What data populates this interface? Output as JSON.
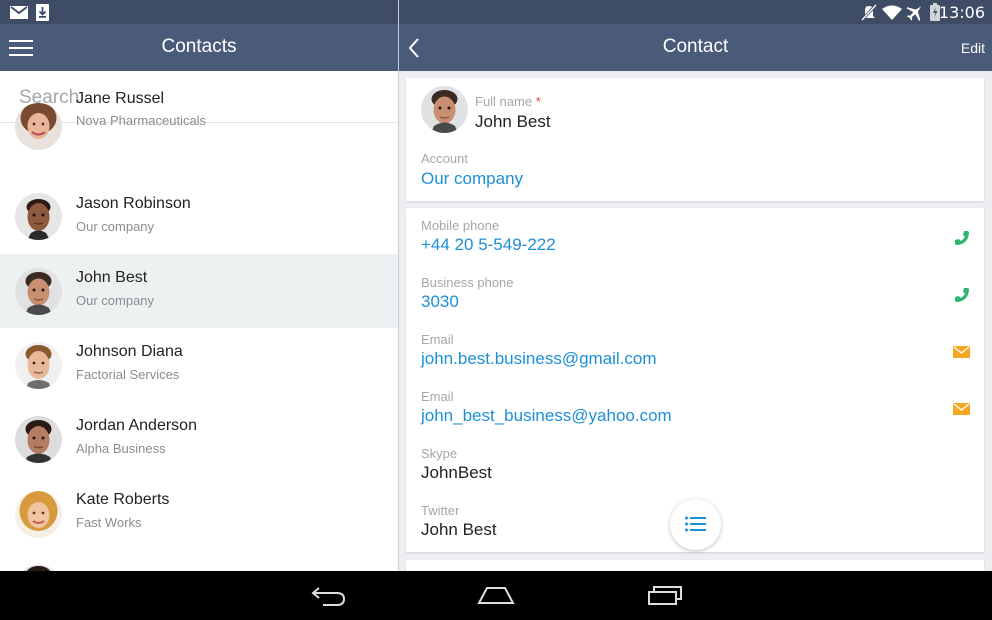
{
  "status_bar": {
    "time": "13:06",
    "icons": [
      "gmail-icon",
      "download-icon",
      "mute-icon",
      "wifi-icon",
      "airplane-icon",
      "battery-icon"
    ]
  },
  "left_header": {
    "title": "Contacts"
  },
  "right_header": {
    "title": "Contact",
    "edit_label": "Edit"
  },
  "search": {
    "placeholder": "Search",
    "value": ""
  },
  "contacts": [
    {
      "name": "Jane Russel",
      "company": "Nova Pharmaceuticals"
    },
    {
      "name": "Jason Robinson",
      "company": "Our company"
    },
    {
      "name": "John Best",
      "company": "Our company",
      "selected": true
    },
    {
      "name": "Johnson Diana",
      "company": "Factorial Services"
    },
    {
      "name": "Jordan Anderson",
      "company": "Alpha Business"
    },
    {
      "name": "Kate Roberts",
      "company": "Fast Works"
    }
  ],
  "contact_detail": {
    "full_name_label": "Full name",
    "required_mark": "*",
    "full_name": "John Best",
    "account_label": "Account",
    "account": "Our company",
    "fields": [
      {
        "label": "Mobile phone",
        "value": "+44 20 5-549-222",
        "icon": "phone-icon"
      },
      {
        "label": "Business phone",
        "value": "3030",
        "icon": "phone-icon"
      },
      {
        "label": "Email",
        "value": "john.best.business@gmail.com",
        "icon": "email-icon"
      },
      {
        "label": "Email",
        "value": "john_best_business@yahoo.com",
        "icon": "email-icon"
      },
      {
        "label": "Skype",
        "value": "JohnBest"
      },
      {
        "label": "Twitter",
        "value": "John Best"
      }
    ]
  },
  "colors": {
    "appbar": "#4a5a79",
    "link": "#1b90d8",
    "phone_icon": "#2bb673",
    "email_icon": "#f5a623",
    "selected_row": "#eef1f1"
  }
}
